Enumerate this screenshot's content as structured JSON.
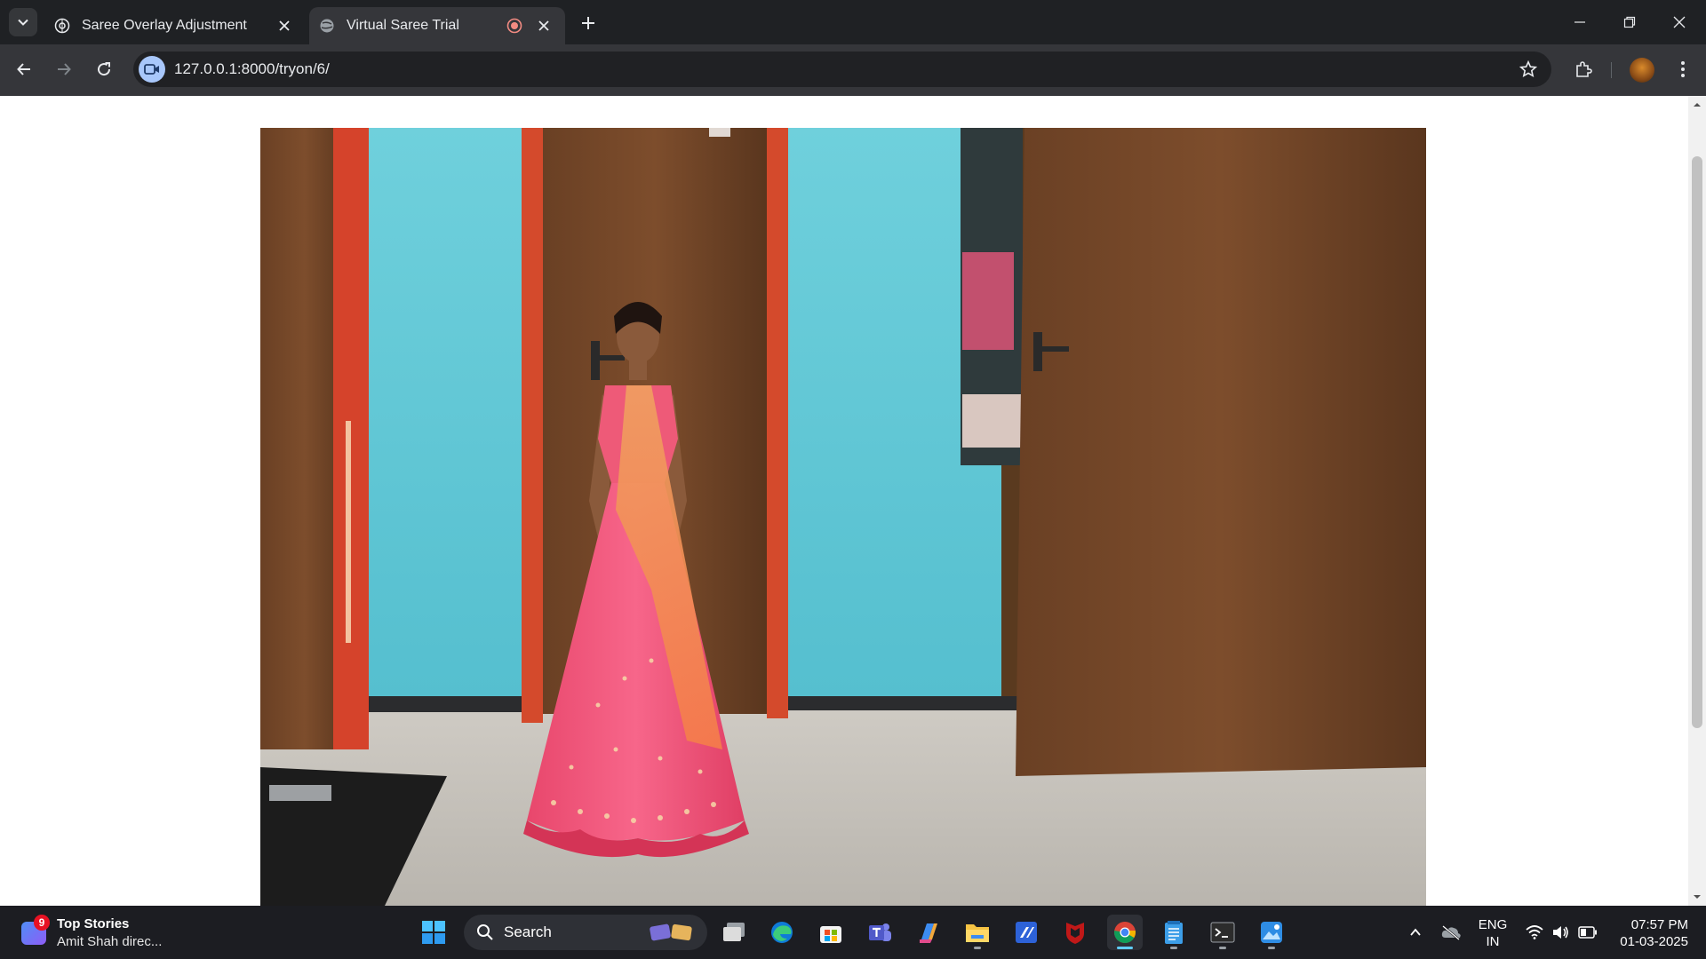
{
  "browser": {
    "tabs": [
      {
        "title": "Saree Overlay Adjustment",
        "active": false
      },
      {
        "title": "Virtual Saree Trial",
        "active": true,
        "recording": true
      }
    ],
    "address": "127.0.0.1:8000/tryon/6/"
  },
  "page": {
    "camera_feed": {
      "description_icon": "live-webcam-feed"
    }
  },
  "taskbar": {
    "news": {
      "badge": "9",
      "title": "Top Stories",
      "subtitle": "Amit Shah direc..."
    },
    "search_label": "Search",
    "pinned_apps": [
      "task-view",
      "edge",
      "microsoft-store",
      "teams",
      "copilot",
      "file-explorer",
      "vscode-like",
      "mcafee",
      "chrome",
      "notepad",
      "terminal",
      "photos"
    ],
    "tray": {
      "lang_line1": "ENG",
      "lang_line2": "IN",
      "time": "07:57 PM",
      "date": "01-03-2025"
    }
  },
  "colors": {
    "tab_bg": "#1f2124",
    "toolbar_bg": "#35363a",
    "taskbar_bg": "#1c1d22",
    "accent": "#a8c7fa",
    "wall": "#5ec9d8",
    "door": "#6b4226",
    "lehenga": "#f0557a"
  }
}
